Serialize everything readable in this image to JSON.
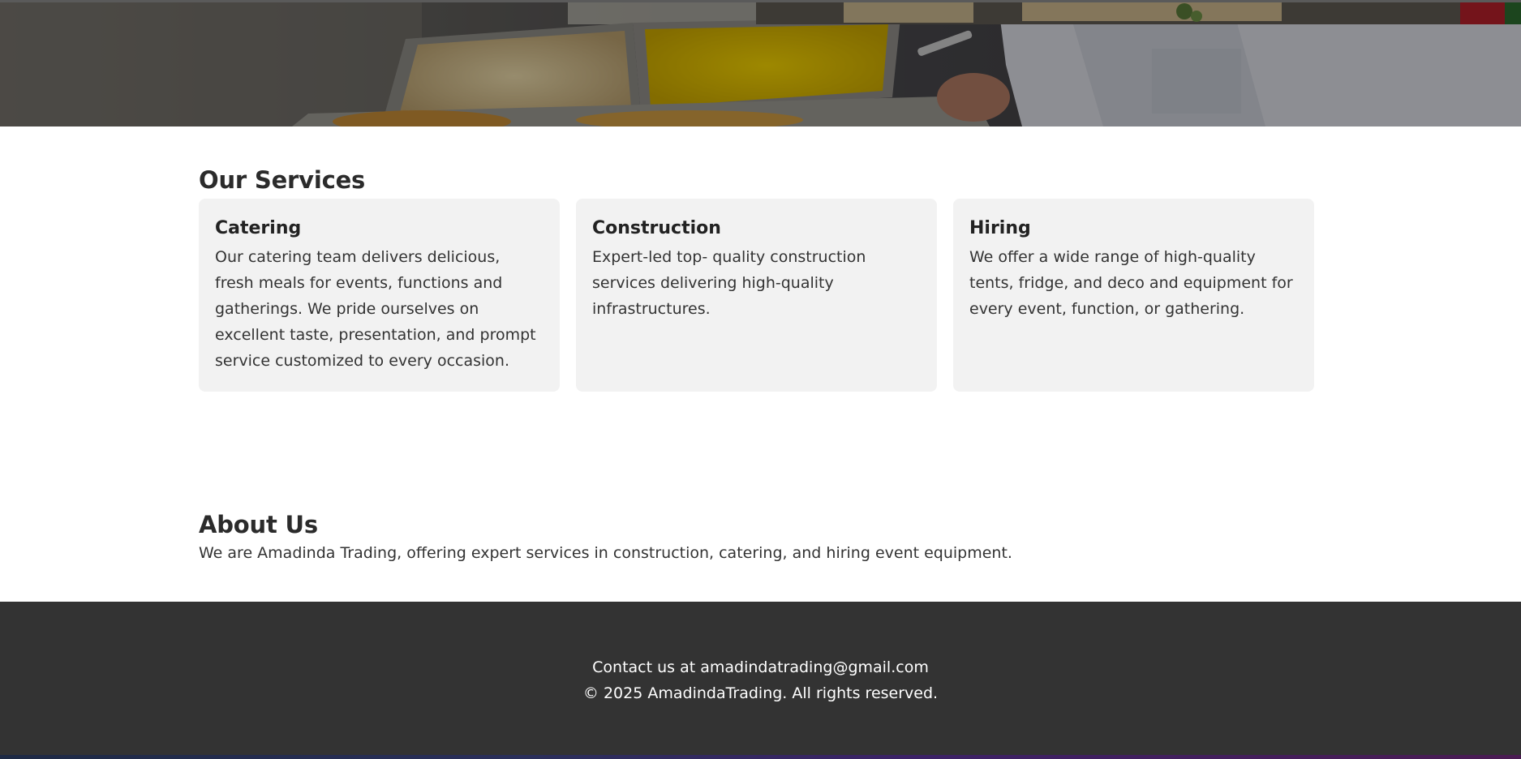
{
  "services": {
    "heading": "Our Services",
    "items": [
      {
        "title": "Catering",
        "text": "Our catering team delivers delicious, fresh meals for events, functions and gatherings. We pride ourselves on excellent taste, presentation, and prompt service customized to every occasion."
      },
      {
        "title": "Construction",
        "text": "Expert-led top- quality construction services delivering high-quality infrastructures."
      },
      {
        "title": "Hiring",
        "text": "We offer a wide range of high-quality tents, fridge, and deco and equipment for every event, function, or gathering."
      }
    ]
  },
  "about": {
    "heading": "About Us",
    "text": "We are Amadinda Trading, offering expert services in construction, catering, and hiring event equipment."
  },
  "footer": {
    "contact": "Contact us at amadindatrading@gmail.com",
    "copyright": "© 2025 AmadindaTrading. All rights reserved."
  }
}
